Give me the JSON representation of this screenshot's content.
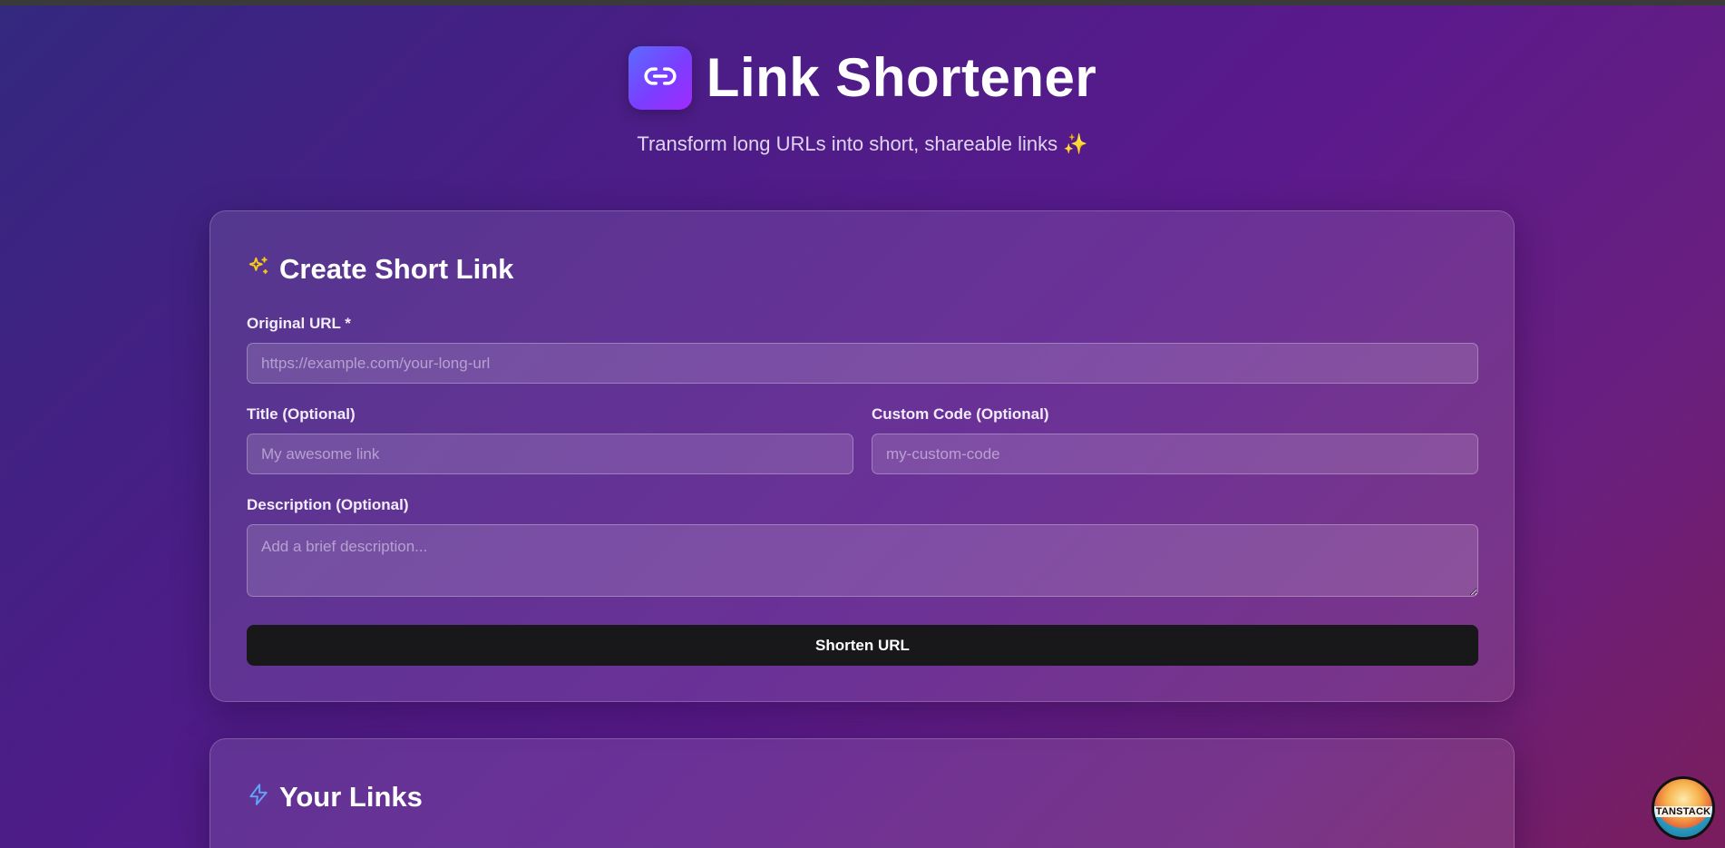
{
  "header": {
    "title": "Link Shortener",
    "subtitle": "Transform long URLs into short, shareable links ✨",
    "logo_icon": "link-icon"
  },
  "create_form": {
    "heading": "Create Short Link",
    "heading_icon": "sparkles-icon",
    "original_url": {
      "label": "Original URL *",
      "placeholder": "https://example.com/your-long-url",
      "value": ""
    },
    "title": {
      "label": "Title (Optional)",
      "placeholder": "My awesome link",
      "value": ""
    },
    "custom_code": {
      "label": "Custom Code (Optional)",
      "placeholder": "my-custom-code",
      "value": ""
    },
    "description": {
      "label": "Description (Optional)",
      "placeholder": "Add a brief description...",
      "value": ""
    },
    "submit_label": "Shorten URL"
  },
  "links_section": {
    "heading": "Your Links",
    "heading_icon": "lightning-icon"
  },
  "badge": {
    "label": "TANSTACK"
  },
  "colors": {
    "accent_gradient_start": "#5b6cff",
    "accent_gradient_end": "#a12bff",
    "button_bg": "#18181b",
    "sparkle_icon": "#facc15",
    "lightning_icon": "#60a5fa"
  }
}
